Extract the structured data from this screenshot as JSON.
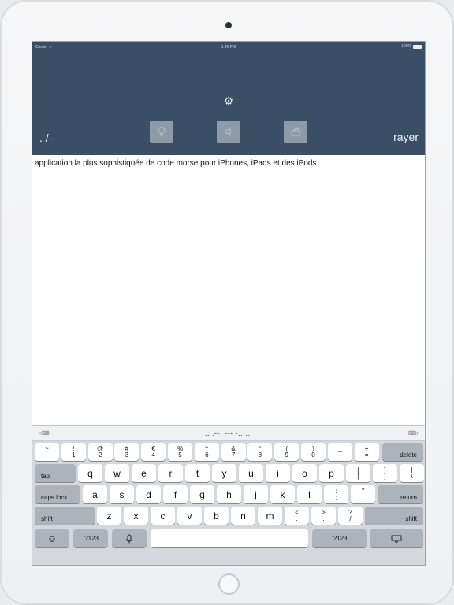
{
  "status": {
    "carrier": "Carrier ᯤ",
    "time": "1:40 PM",
    "battery": "100%"
  },
  "toolbar": {
    "morse_label": ". / -",
    "clear_label": "rayer",
    "settings_icon": "gear-icon",
    "buttons": [
      "lightbulb-icon",
      "speaker-icon",
      "share-icon"
    ]
  },
  "text": {
    "content": "application la plus sophistiquée de code morse pour iPhones, iPads et des iPods"
  },
  "suggestion": {
    "morse": ".. .--. --- -.. ..."
  },
  "keyboard": {
    "row1": [
      [
        "~",
        "`"
      ],
      [
        "!",
        "1"
      ],
      [
        "@",
        "2"
      ],
      [
        "#",
        "3"
      ],
      [
        "€",
        "4"
      ],
      [
        "%",
        "5"
      ],
      [
        "^",
        "6"
      ],
      [
        "&",
        "7"
      ],
      [
        "*",
        "8"
      ],
      [
        "(",
        "9"
      ],
      [
        ")",
        "0"
      ],
      [
        "_",
        "-"
      ],
      [
        "+",
        "="
      ]
    ],
    "delete": "delete",
    "tab": "tab",
    "row2": [
      "q",
      "w",
      "e",
      "r",
      "t",
      "y",
      "u",
      "i",
      "o",
      "p"
    ],
    "row2_extra": [
      [
        "{",
        "["
      ],
      [
        "}",
        "]"
      ],
      [
        "|",
        "\\"
      ]
    ],
    "caps_lock": "caps lock",
    "row3": [
      "a",
      "s",
      "d",
      "f",
      "g",
      "h",
      "j",
      "k",
      "l"
    ],
    "row3_extra": [
      [
        ":",
        ";"
      ],
      [
        "\"",
        "'"
      ]
    ],
    "return": "return",
    "shift_left": "shift",
    "row4": [
      "z",
      "x",
      "c",
      "v",
      "b",
      "n",
      "m"
    ],
    "row4_extra": [
      [
        "<",
        ","
      ],
      [
        ">",
        "."
      ],
      [
        "?",
        "/"
      ]
    ],
    "shift_right": "shift",
    "emoji": "☺",
    "num_left": ".?123",
    "mic": "mic-icon",
    "num_right": ".?123",
    "hide": "keyboard-icon"
  }
}
